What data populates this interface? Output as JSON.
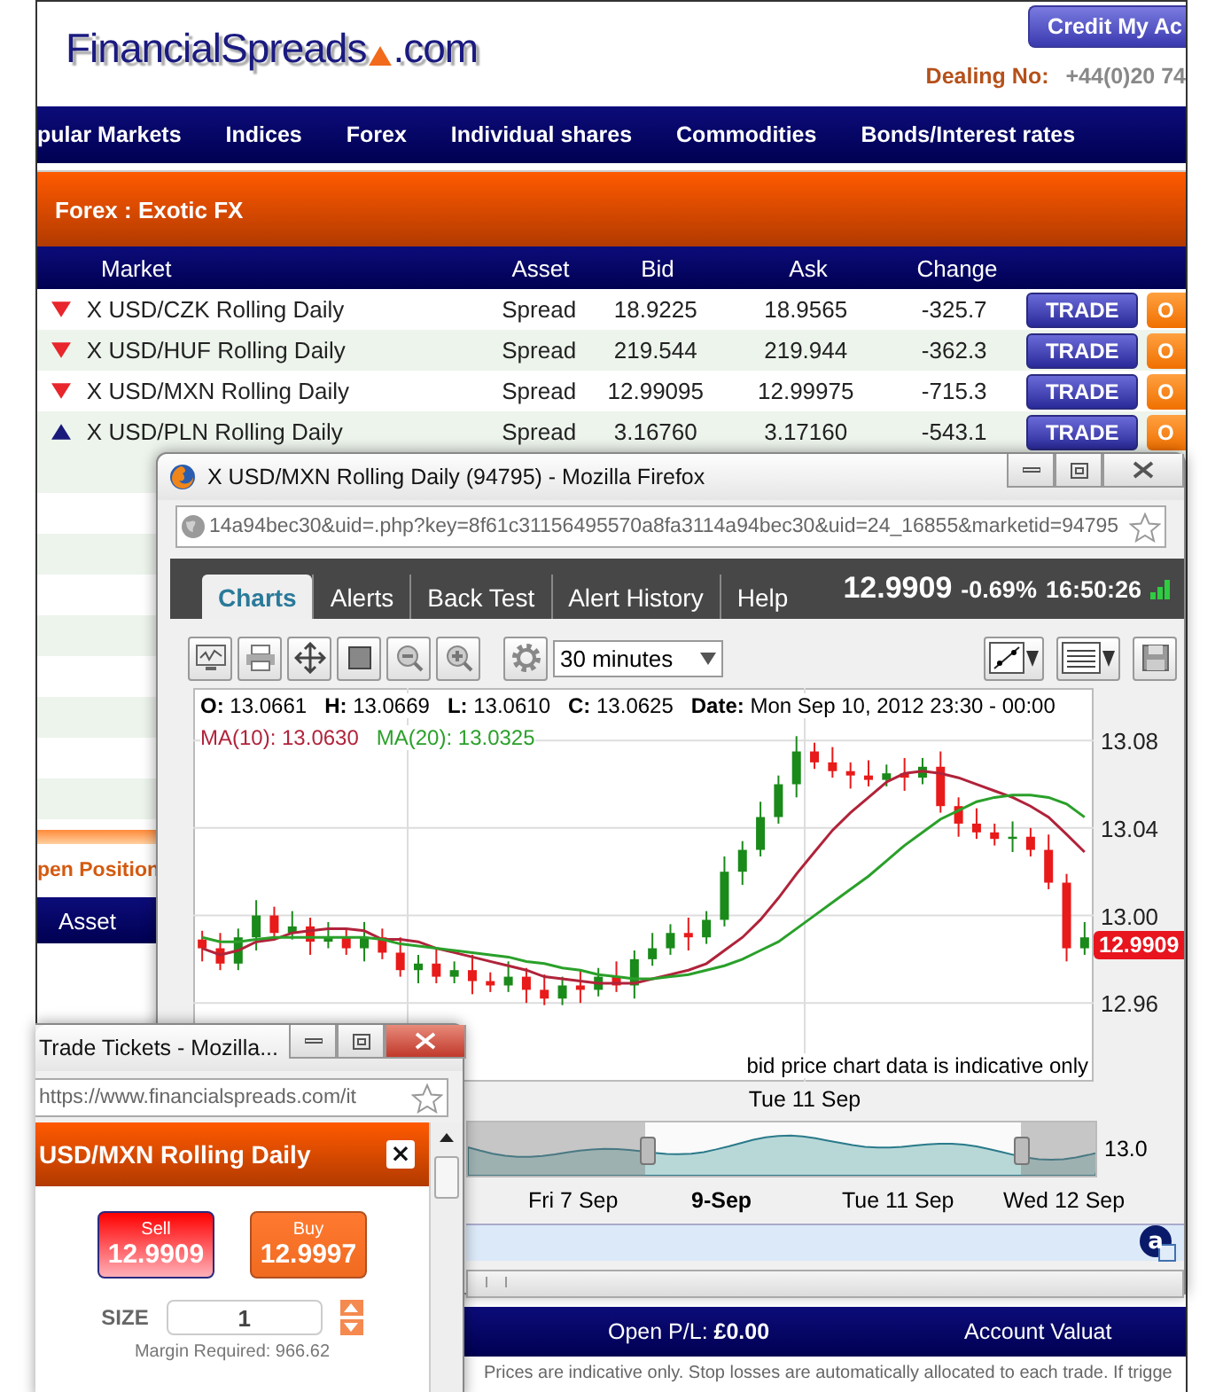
{
  "site": {
    "logo_name": "FinancialSpreads",
    "logo_suffix": ".com",
    "credit_button": "Credit My Ac",
    "dealing_label": "Dealing No:",
    "dealing_number": "+44(0)20 74"
  },
  "nav": [
    "pular Markets",
    "Indices",
    "Forex",
    "Individual shares",
    "Commodities",
    "Bonds/Interest rates"
  ],
  "section_title": "Forex : Exotic FX",
  "markets": {
    "columns": [
      "Market",
      "Asset",
      "Bid",
      "Ask",
      "Change"
    ],
    "rows": [
      {
        "rising": false,
        "market": "X USD/CZK Rolling Daily",
        "asset": "Spread",
        "bid": "18.9225",
        "ask": "18.9565",
        "change": "-325.7",
        "trade": "TRADE",
        "order": "O"
      },
      {
        "rising": false,
        "market": "X USD/HUF Rolling Daily",
        "asset": "Spread",
        "bid": "219.544",
        "ask": "219.944",
        "change": "-362.3",
        "trade": "TRADE",
        "order": "O"
      },
      {
        "rising": false,
        "market": "X USD/MXN Rolling Daily",
        "asset": "Spread",
        "bid": "12.99095",
        "ask": "12.99975",
        "change": "-715.3",
        "trade": "TRADE",
        "order": "O"
      },
      {
        "rising": true,
        "market": "X USD/PLN Rolling Daily",
        "asset": "Spread",
        "bid": "3.16760",
        "ask": "3.17160",
        "change": "-543.1",
        "trade": "TRADE",
        "order": "O"
      }
    ]
  },
  "positions": {
    "title": "pen Position",
    "column": "Asset"
  },
  "footer": {
    "open_pl_label": "Open P/L:",
    "open_pl": "£0.00",
    "account": "Account Valuat",
    "disclaimer": "Prices are indicative only. Stop losses are automatically allocated to each trade. If trigge"
  },
  "chart_window": {
    "title": "X USD/MXN Rolling Daily (94795) - Mozilla Firefox",
    "url": "14a94bec30&uid=.php?key=8f61c31156495570a8fa3114a94bec30&uid=24_16855&marketid=94795",
    "tabs": [
      {
        "label": "Charts",
        "selected": true
      },
      {
        "label": "Alerts",
        "selected": false
      },
      {
        "label": "Back Test",
        "selected": false
      },
      {
        "label": "Alert History",
        "selected": false
      },
      {
        "label": "Help",
        "selected": false
      }
    ],
    "price": "12.9909",
    "change": "-0.69%",
    "time": "16:50:26",
    "interval": "30 minutes",
    "ohlc": [
      {
        "label": "O:",
        "value": "13.0661"
      },
      {
        "label": "H:",
        "value": "13.0669"
      },
      {
        "label": "L:",
        "value": "13.0610"
      },
      {
        "label": "C:",
        "value": "13.0625"
      },
      {
        "label": "Date:",
        "value": "Mon Sep 10, 2012 23:30 - 00:00"
      }
    ],
    "chart_data": {
      "type": "candlestick",
      "grid": true,
      "categories": [
        null,
        null,
        null,
        null,
        null,
        null,
        null,
        null,
        null,
        null,
        null,
        null,
        null,
        null,
        null,
        null,
        null,
        null,
        null,
        null,
        null,
        null,
        null,
        null,
        null,
        null,
        null,
        null,
        null,
        null,
        null,
        null,
        null,
        null,
        null,
        null,
        null,
        null,
        null,
        null,
        null,
        null,
        null,
        null,
        null,
        null,
        null,
        null,
        null,
        null
      ],
      "ylim": [
        12.924,
        13.104
      ],
      "yticks": [
        {
          "value": 13.08,
          "label": "13.08"
        },
        {
          "value": 13.04,
          "label": "13.04"
        },
        {
          "value": 13.0,
          "label": "13.00"
        },
        {
          "value": 12.96,
          "label": "12.96"
        }
      ],
      "ohlc": [
        [
          12.989,
          12.993,
          12.979,
          12.985
        ],
        [
          12.985,
          12.992,
          12.975,
          12.978
        ],
        [
          12.978,
          12.994,
          12.975,
          12.99
        ],
        [
          12.99,
          13.007,
          12.984,
          13.0
        ],
        [
          13.0,
          13.004,
          12.989,
          12.992
        ],
        [
          12.992,
          13.002,
          12.989,
          12.995
        ],
        [
          12.995,
          12.999,
          12.982,
          12.988
        ],
        [
          12.988,
          12.997,
          12.985,
          12.99
        ],
        [
          12.99,
          12.994,
          12.982,
          12.985
        ],
        [
          12.985,
          12.997,
          12.979,
          12.99
        ],
        [
          12.99,
          12.994,
          12.98,
          12.983
        ],
        [
          12.983,
          12.99,
          12.972,
          12.975
        ],
        [
          12.975,
          12.982,
          12.969,
          12.978
        ],
        [
          12.978,
          12.985,
          12.969,
          12.972
        ],
        [
          12.972,
          12.979,
          12.969,
          12.975
        ],
        [
          12.975,
          12.982,
          12.964,
          12.97
        ],
        [
          12.97,
          12.974,
          12.965,
          12.968
        ],
        [
          12.968,
          12.979,
          12.965,
          12.972
        ],
        [
          12.972,
          12.976,
          12.96,
          12.966
        ],
        [
          12.966,
          12.973,
          12.959,
          12.962
        ],
        [
          12.962,
          12.972,
          12.959,
          12.968
        ],
        [
          12.968,
          12.975,
          12.96,
          12.966
        ],
        [
          12.966,
          12.976,
          12.963,
          12.972
        ],
        [
          12.972,
          12.979,
          12.965,
          12.968
        ],
        [
          12.968,
          12.984,
          12.962,
          12.98
        ],
        [
          12.98,
          12.992,
          12.977,
          12.985
        ],
        [
          12.985,
          12.996,
          12.982,
          12.992
        ],
        [
          12.992,
          12.999,
          12.984,
          12.99
        ],
        [
          12.99,
          13.002,
          12.987,
          12.998
        ],
        [
          12.998,
          13.027,
          12.995,
          13.02
        ],
        [
          13.02,
          13.034,
          13.014,
          13.03
        ],
        [
          13.03,
          13.052,
          13.027,
          13.045
        ],
        [
          13.045,
          13.064,
          13.042,
          13.06
        ],
        [
          13.06,
          13.082,
          13.054,
          13.075
        ],
        [
          13.075,
          13.079,
          13.067,
          13.07
        ],
        [
          13.07,
          13.077,
          13.063,
          13.066
        ],
        [
          13.066,
          13.07,
          13.058,
          13.064
        ],
        [
          13.064,
          13.071,
          13.059,
          13.062
        ],
        [
          13.062,
          13.069,
          13.059,
          13.065
        ],
        [
          13.065,
          13.072,
          13.057,
          13.063
        ],
        [
          13.063,
          13.072,
          13.06,
          13.068
        ],
        [
          13.068,
          13.075,
          13.047,
          13.05
        ],
        [
          13.05,
          13.054,
          13.036,
          13.042
        ],
        [
          13.042,
          13.049,
          13.035,
          13.038
        ],
        [
          13.038,
          13.042,
          13.032,
          13.035
        ],
        [
          13.035,
          13.043,
          13.029,
          13.036
        ],
        [
          13.036,
          13.04,
          13.027,
          13.03
        ],
        [
          13.03,
          13.037,
          13.012,
          13.015
        ],
        [
          13.015,
          13.019,
          12.979,
          12.985
        ],
        [
          12.985,
          12.997,
          12.982,
          12.99
        ]
      ],
      "series": [
        {
          "name": "MA(10): 13.0630",
          "type": "line",
          "color": "#b0233a",
          "values": [
            12.985,
            12.982,
            12.984,
            12.988,
            12.989,
            12.992,
            12.993,
            12.994,
            12.994,
            12.993,
            12.989,
            12.989,
            12.988,
            12.985,
            12.983,
            12.981,
            12.979,
            12.977,
            12.975,
            12.972,
            12.971,
            12.97,
            12.969,
            12.969,
            12.969,
            12.971,
            12.973,
            12.975,
            12.978,
            12.984,
            12.99,
            12.998,
            13.008,
            13.019,
            13.029,
            13.039,
            13.047,
            13.054,
            13.061,
            13.065,
            13.066,
            13.065,
            13.063,
            13.06,
            13.057,
            13.054,
            13.05,
            13.045,
            13.037,
            13.029
          ]
        },
        {
          "name": "MA(20): 13.0325",
          "type": "line",
          "color": "#2aa02a",
          "values": [
            12.99,
            12.988,
            12.988,
            12.989,
            12.99,
            12.99,
            12.99,
            12.99,
            12.99,
            12.99,
            12.989,
            12.987,
            12.986,
            12.985,
            12.984,
            12.983,
            12.982,
            12.981,
            12.979,
            12.978,
            12.976,
            12.975,
            12.973,
            12.972,
            12.971,
            12.971,
            12.972,
            12.973,
            12.975,
            12.977,
            12.98,
            12.984,
            12.988,
            12.994,
            13.0,
            13.006,
            13.012,
            13.018,
            13.025,
            13.032,
            13.038,
            13.044,
            13.048,
            13.052,
            13.054,
            13.055,
            13.055,
            13.054,
            13.051,
            13.045
          ]
        }
      ]
    },
    "price_tag": "12.9909",
    "note": "bid price chart data is indicative only",
    "x_label": "Tue 11 Sep",
    "navigator_tick": "13.0",
    "navigator_labels": [
      {
        "text": "Fri 7 Sep",
        "bold": false
      },
      {
        "text": "9-Sep",
        "bold": true
      },
      {
        "text": "Tue 11 Sep",
        "bold": false
      },
      {
        "text": "Wed 12 Sep",
        "bold": false
      }
    ],
    "badge": "a"
  },
  "ticket_window": {
    "title": "Trade Tickets - Mozilla...",
    "url": "https://www.financialspreads.com/it",
    "market": "USD/MXN Rolling Daily",
    "close": "×",
    "sell_label": "Sell",
    "sell_price": "12.9909",
    "buy_label": "Buy",
    "buy_price": "12.9997",
    "size_label": "SIZE",
    "size": "1",
    "margin": "Margin Required: 966.62"
  }
}
